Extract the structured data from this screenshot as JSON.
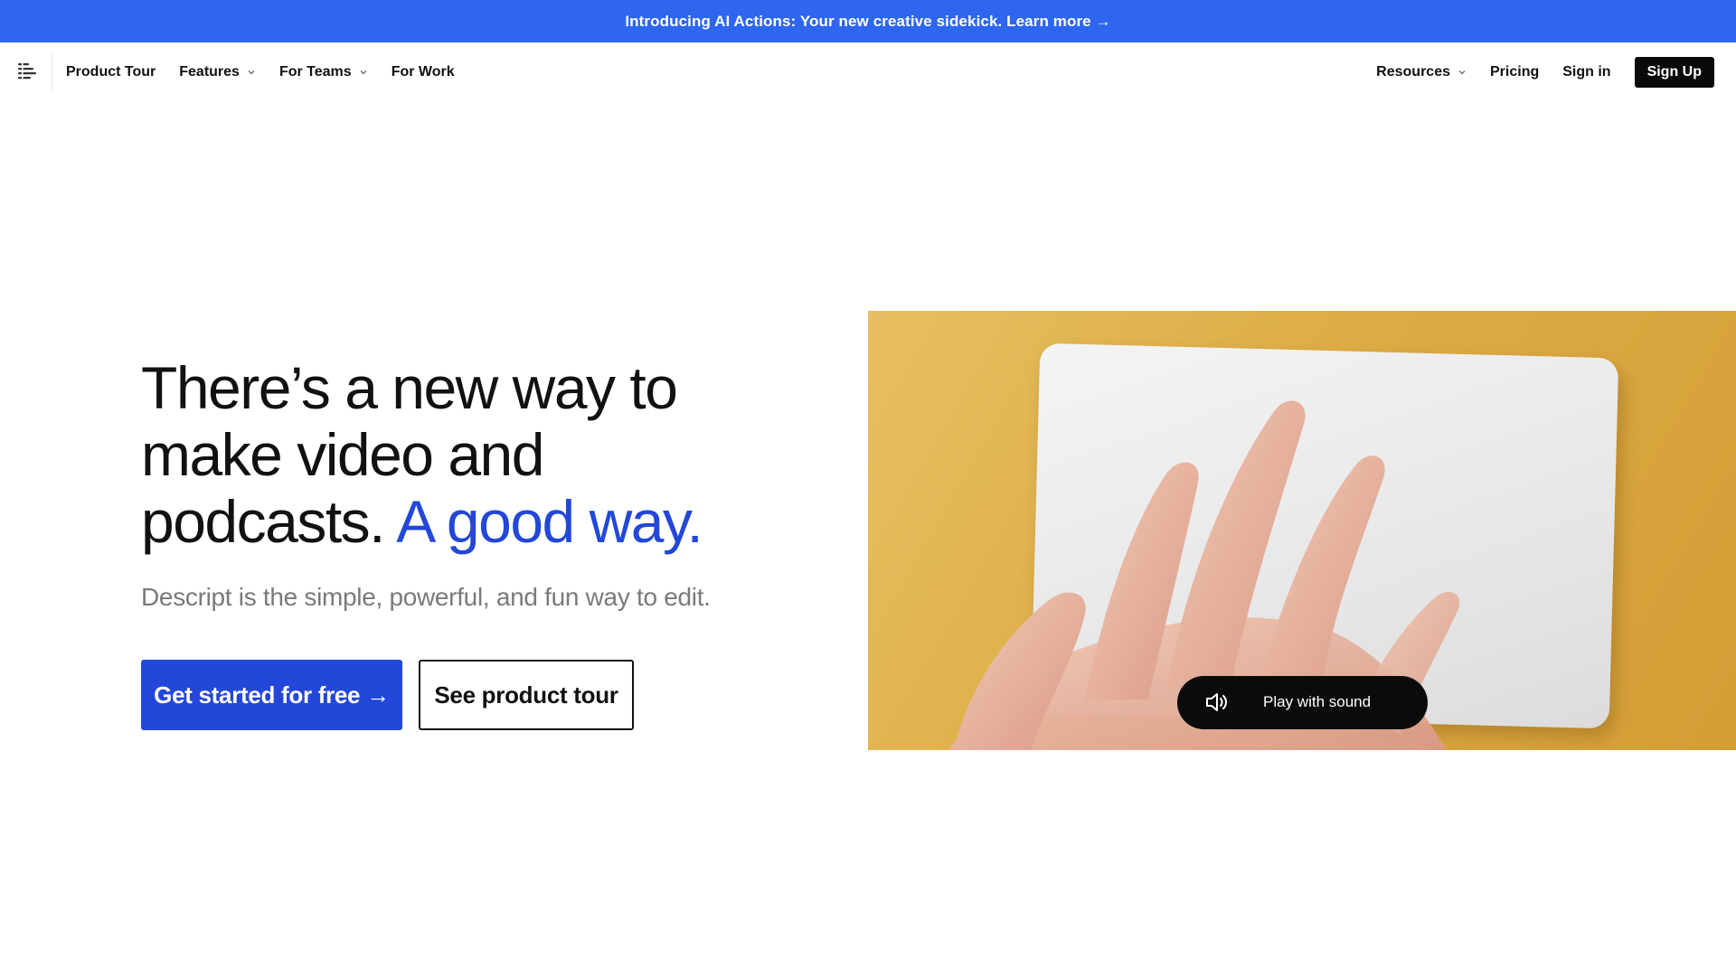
{
  "announcement": {
    "text": "Introducing AI Actions: Your new creative sidekick. Learn more →"
  },
  "nav": {
    "logo_icon": "descript-logo-icon",
    "left_items": [
      {
        "label": "Product Tour",
        "has_dropdown": false
      },
      {
        "label": "Features",
        "has_dropdown": true
      },
      {
        "label": "For Teams",
        "has_dropdown": true
      },
      {
        "label": "For Work",
        "has_dropdown": false
      }
    ],
    "right_items": [
      {
        "label": "Resources",
        "has_dropdown": true
      },
      {
        "label": "Pricing",
        "has_dropdown": false
      },
      {
        "label": "Sign in",
        "has_dropdown": false
      }
    ],
    "signup_label": "Sign Up"
  },
  "hero": {
    "title_main": "There’s a new way to make video and podcasts.",
    "title_accent": "A good way.",
    "subtitle": "Descript is the simple, powerful, and fun way to edit.",
    "primary_cta": "Get started for free →",
    "secondary_cta": "See product tour"
  },
  "video": {
    "play_label": "Play with sound",
    "play_icon": "speaker-icon"
  },
  "colors": {
    "announcement_bg": "#2e66f0",
    "accent": "#2347d8",
    "text": "#111111",
    "muted": "#7a7a7a"
  }
}
